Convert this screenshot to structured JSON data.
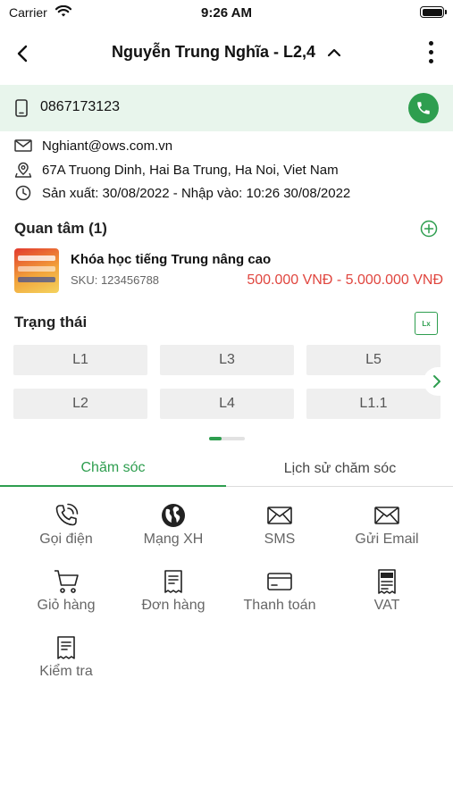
{
  "status_bar": {
    "carrier": "Carrier",
    "time": "9:26 AM"
  },
  "header": {
    "title": "Nguyễn Trung Nghĩa - L2,4"
  },
  "contact": {
    "phone": "0867173123",
    "email": "Nghiant@ows.com.vn",
    "address": "67A Truong Dinh, Hai Ba Trung, Ha Noi, Viet Nam",
    "dates": "Sản xuất: 30/08/2022  - Nhập vào: 10:26 30/08/2022"
  },
  "interest": {
    "title": "Quan tâm (1)",
    "products": [
      {
        "name": "Khóa học tiếng Trung nâng cao",
        "sku": "SKU: 123456788",
        "price": "500.000 VNĐ - 5.000.000 VNĐ"
      }
    ]
  },
  "status_section": {
    "title": "Trạng thái",
    "lx_label": "Lx",
    "chips": [
      "L1",
      "L3",
      "L5",
      "L2",
      "L4",
      "L1.1"
    ]
  },
  "tabs": [
    {
      "label": "Chăm sóc",
      "active": true
    },
    {
      "label": "Lịch sử chăm sóc",
      "active": false
    }
  ],
  "actions": [
    {
      "label": "Gọi điện",
      "icon": "phone-call-icon"
    },
    {
      "label": "Mạng XH",
      "icon": "globe-icon"
    },
    {
      "label": "SMS",
      "icon": "envelope-icon"
    },
    {
      "label": "Gửi Email",
      "icon": "envelope-icon"
    },
    {
      "label": "Giỏ hàng",
      "icon": "cart-icon"
    },
    {
      "label": "Đơn hàng",
      "icon": "receipt-icon"
    },
    {
      "label": "Thanh toán",
      "icon": "card-icon"
    },
    {
      "label": "VAT",
      "icon": "vat-invoice-icon"
    },
    {
      "label": "Kiểm tra",
      "icon": "receipt-icon"
    }
  ],
  "colors": {
    "accent": "#2e9e4f",
    "price": "#e0463f",
    "phone_row_bg": "#e8f5ec",
    "chip_bg": "#efefef"
  }
}
